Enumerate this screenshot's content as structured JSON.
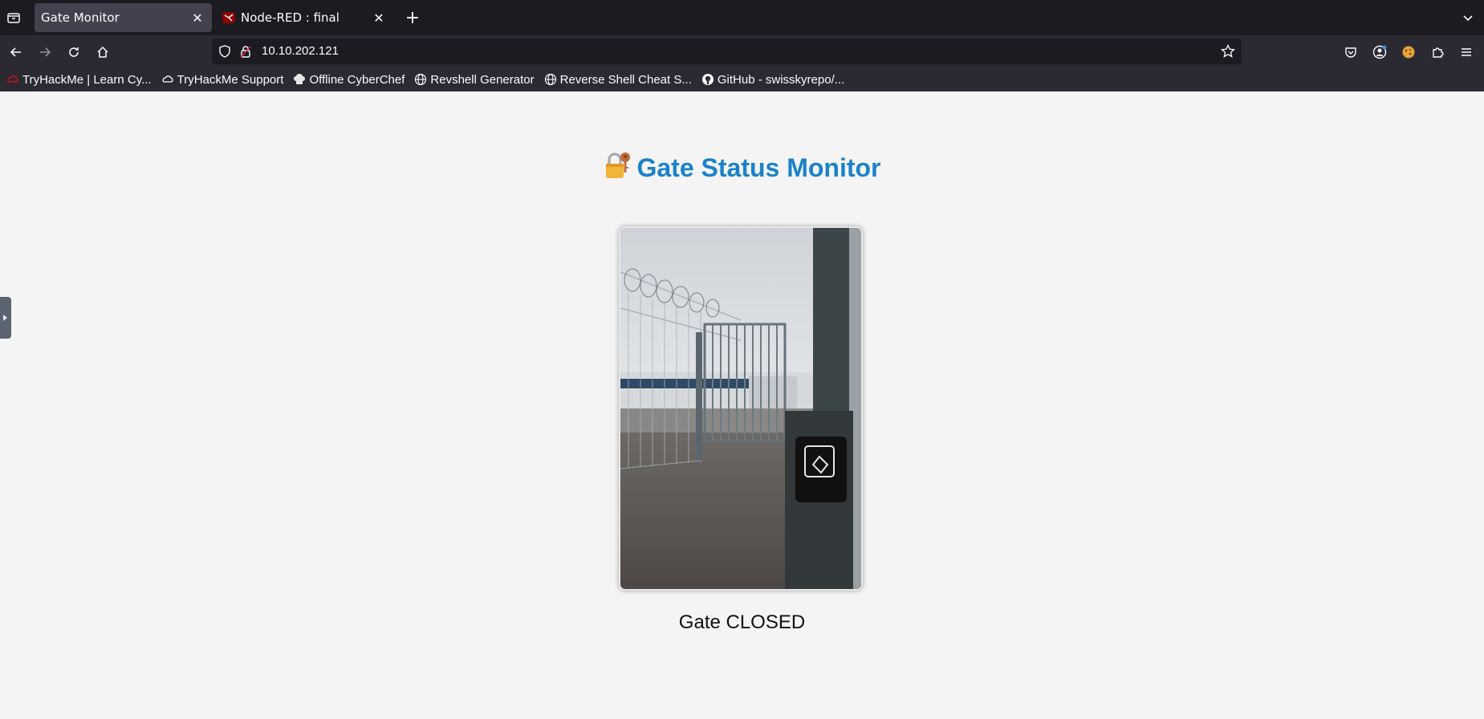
{
  "browser": {
    "tabs": [
      {
        "title": "Gate Monitor",
        "active": true
      },
      {
        "title": "Node-RED : final",
        "active": false
      }
    ],
    "url": "10.10.202.121",
    "bookmarks": [
      {
        "label": "TryHackMe | Learn Cy...",
        "icon": "tryhackme-icon"
      },
      {
        "label": "TryHackMe Support",
        "icon": "cloud-icon"
      },
      {
        "label": "Offline CyberChef",
        "icon": "chef-hat-icon"
      },
      {
        "label": "Revshell Generator",
        "icon": "globe-icon"
      },
      {
        "label": "Reverse Shell Cheat S...",
        "icon": "globe-icon"
      },
      {
        "label": "GitHub - swisskyrepo/...",
        "icon": "github-icon"
      }
    ]
  },
  "page": {
    "title": "Gate Status Monitor",
    "title_icon": "lock-with-key-icon",
    "image_alt": "gate-photo",
    "status": "Gate CLOSED"
  },
  "colors": {
    "title": "#1a82c8",
    "tabbar_bg": "#1c1b22",
    "toolbar_bg": "#2b2a33",
    "page_bg": "#f4f4f4"
  }
}
